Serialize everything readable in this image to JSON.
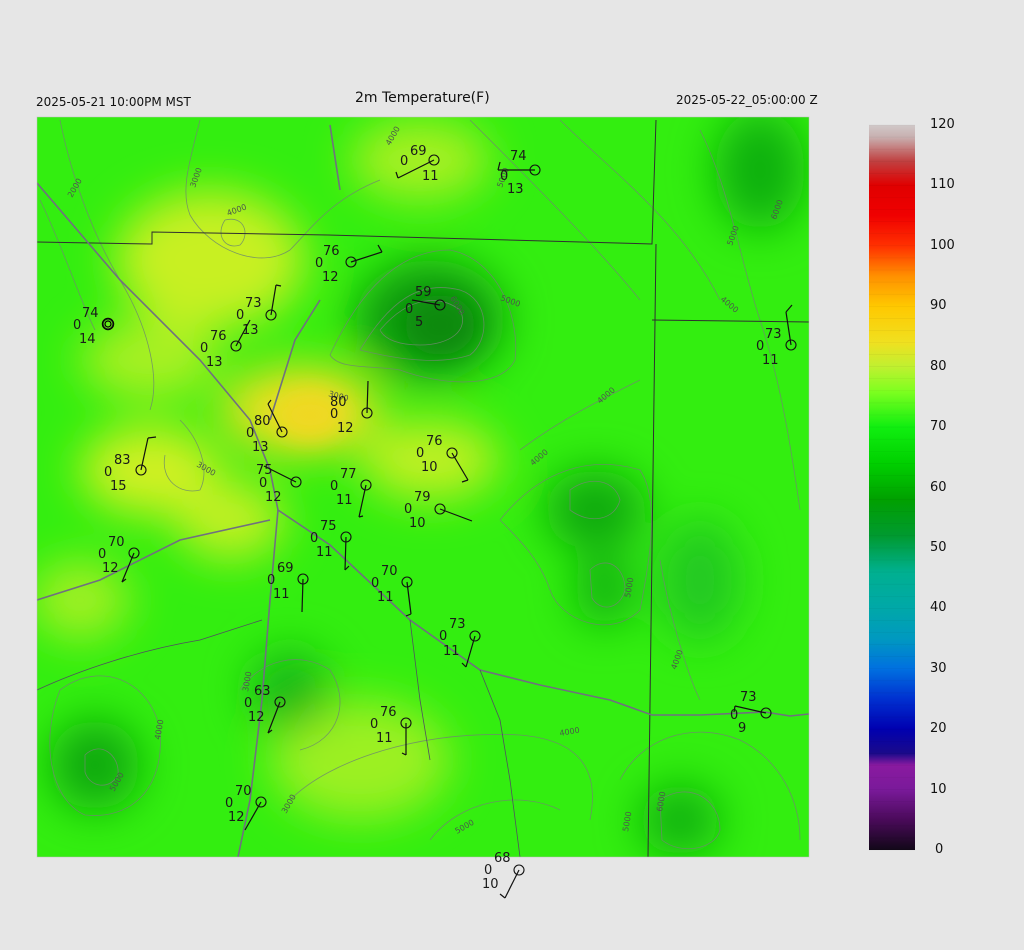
{
  "header": {
    "left_time": "2025-05-21 10:00PM MST",
    "title": "2m Temperature(F)",
    "right_time": "2025-05-22_05:00:00 Z"
  },
  "colorbar": {
    "labels": [
      "120",
      "110",
      "100",
      "90",
      "80",
      "70",
      "60",
      "50",
      "40",
      "30",
      "20",
      "10",
      "0"
    ],
    "stops": [
      {
        "v": 0,
        "c": "#120818"
      },
      {
        "v": 5,
        "c": "#4a0a5a"
      },
      {
        "v": 10,
        "c": "#7a1a9a"
      },
      {
        "v": 14,
        "c": "#8a1aa0"
      },
      {
        "v": 16,
        "c": "#1a0a8a"
      },
      {
        "v": 20,
        "c": "#0000b0"
      },
      {
        "v": 25,
        "c": "#0030d0"
      },
      {
        "v": 30,
        "c": "#0070e0"
      },
      {
        "v": 35,
        "c": "#0099c0"
      },
      {
        "v": 40,
        "c": "#00a8a8"
      },
      {
        "v": 46,
        "c": "#00b090"
      },
      {
        "v": 52,
        "c": "#009a30"
      },
      {
        "v": 58,
        "c": "#00a000"
      },
      {
        "v": 64,
        "c": "#00d000"
      },
      {
        "v": 70,
        "c": "#10ef10"
      },
      {
        "v": 76,
        "c": "#80ff20"
      },
      {
        "v": 80,
        "c": "#c0f030"
      },
      {
        "v": 84,
        "c": "#f0e020"
      },
      {
        "v": 90,
        "c": "#ffc800"
      },
      {
        "v": 95,
        "c": "#ff9000"
      },
      {
        "v": 100,
        "c": "#ff3000"
      },
      {
        "v": 105,
        "c": "#f00000"
      },
      {
        "v": 110,
        "c": "#e00000"
      },
      {
        "v": 114,
        "c": "#c04040"
      },
      {
        "v": 118,
        "c": "#c8b0b0"
      },
      {
        "v": 120,
        "c": "#d0c8c8"
      }
    ]
  },
  "contour_labels": [
    "2000",
    "3000",
    "4000",
    "4000",
    "5000",
    "6000",
    "3000",
    "3000",
    "4000",
    "5000",
    "4000",
    "5000",
    "6000",
    "4000",
    "5000",
    "4000",
    "5000",
    "3000",
    "4000",
    "5000",
    "3000",
    "4000",
    "6000",
    "5000"
  ],
  "stations": [
    {
      "temp": "69",
      "zero": "0",
      "dew": "11"
    },
    {
      "temp": "74",
      "zero": "0",
      "dew": "13"
    },
    {
      "temp": "76",
      "zero": "0",
      "dew": "12"
    },
    {
      "temp": "59",
      "zero": "0",
      "dew": "5"
    },
    {
      "temp": "73",
      "zero": "0",
      "dew": "13"
    },
    {
      "temp": "76",
      "zero": "0",
      "dew": "13"
    },
    {
      "temp": "74",
      "zero": "0",
      "dew": "14"
    },
    {
      "temp": "73",
      "zero": "0",
      "dew": "11"
    },
    {
      "temp": "80",
      "zero": "0",
      "dew": "12"
    },
    {
      "temp": "80",
      "zero": "0",
      "dew": "13"
    },
    {
      "temp": "83",
      "zero": "0",
      "dew": "15"
    },
    {
      "temp": "76",
      "zero": "0",
      "dew": "10"
    },
    {
      "temp": "75",
      "zero": "0",
      "dew": "12"
    },
    {
      "temp": "77",
      "zero": "0",
      "dew": "11"
    },
    {
      "temp": "79",
      "zero": "0",
      "dew": "10"
    },
    {
      "temp": "75",
      "zero": "0",
      "dew": "11"
    },
    {
      "temp": "70",
      "zero": "0",
      "dew": "12"
    },
    {
      "temp": "69",
      "zero": "0",
      "dew": "11"
    },
    {
      "temp": "70",
      "zero": "0",
      "dew": "11"
    },
    {
      "temp": "73",
      "zero": "0",
      "dew": "11"
    },
    {
      "temp": "63",
      "zero": "0",
      "dew": "12"
    },
    {
      "temp": "73",
      "zero": "0",
      "dew": "9"
    },
    {
      "temp": "76",
      "zero": "0",
      "dew": "11"
    },
    {
      "temp": "70",
      "zero": "0",
      "dew": "12"
    },
    {
      "temp": "68",
      "zero": "0",
      "dew": "10"
    }
  ]
}
